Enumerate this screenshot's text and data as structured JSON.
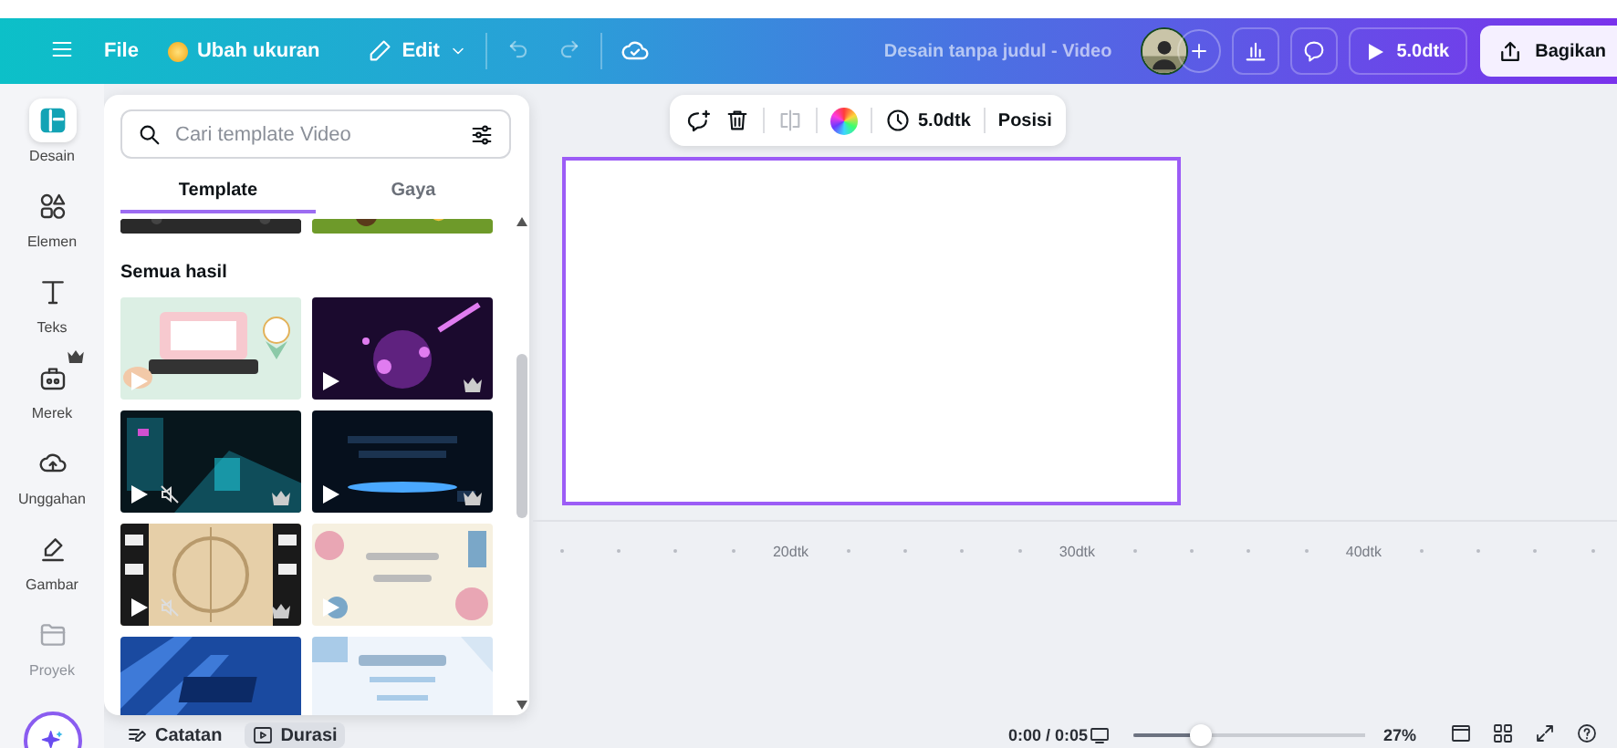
{
  "topbar": {
    "items": [
      {
        "kind": "text",
        "label": "File"
      },
      {
        "kind": "resize",
        "label": "Ubah ukuran"
      },
      {
        "kind": "edit",
        "label": "Edit"
      }
    ],
    "title": "Desain tanpa judul - Video",
    "play_label": "5.0dtk",
    "share_label": "Bagikan"
  },
  "rail": [
    {
      "kind": "design",
      "label": "Desain",
      "selected": true,
      "disabled": false
    },
    {
      "kind": "elements",
      "label": "Elemen",
      "selected": false,
      "disabled": false
    },
    {
      "kind": "text",
      "label": "Teks",
      "selected": false,
      "disabled": false
    },
    {
      "kind": "brand",
      "label": "Merek",
      "selected": false,
      "disabled": false
    },
    {
      "kind": "upload",
      "label": "Unggahan",
      "selected": false,
      "disabled": false
    },
    {
      "kind": "draw",
      "label": "Gambar",
      "selected": false,
      "disabled": false
    },
    {
      "kind": "folder",
      "label": "Proyek",
      "selected": false,
      "disabled": true
    }
  ],
  "panel": {
    "search": {
      "placeholder": "Cari template Video"
    },
    "tabs": [
      {
        "label": "Template",
        "selected": true
      },
      {
        "label": "Gaya",
        "selected": false
      }
    ],
    "section_title": "Semua hasil",
    "thumbnails": [
      {
        "kind": "picture"
      },
      {
        "kind": "picture"
      },
      {
        "kind": "picture",
        "muted": false,
        "premium": false
      },
      {
        "kind": "picture",
        "muted": false,
        "premium": true
      },
      {
        "kind": "picture",
        "muted": true,
        "premium": true
      },
      {
        "kind": "picture",
        "muted": false,
        "premium": true
      },
      {
        "kind": "picture",
        "muted": true,
        "premium": true
      },
      {
        "kind": "picture",
        "muted": false,
        "premium": false
      },
      {
        "kind": "picture"
      },
      {
        "kind": "picture"
      }
    ]
  },
  "toolbar": {
    "duration": "5.0dtk",
    "position": "Posisi"
  },
  "timeline": {
    "ticks": [
      "20dtk",
      "30dtk",
      "40dtk"
    ]
  },
  "bottom": {
    "notes": "Catatan",
    "duration_tab": "Durasi",
    "time": "0:00 / 0:05",
    "zoom": {
      "level": 0.29,
      "reading": "27%"
    }
  }
}
